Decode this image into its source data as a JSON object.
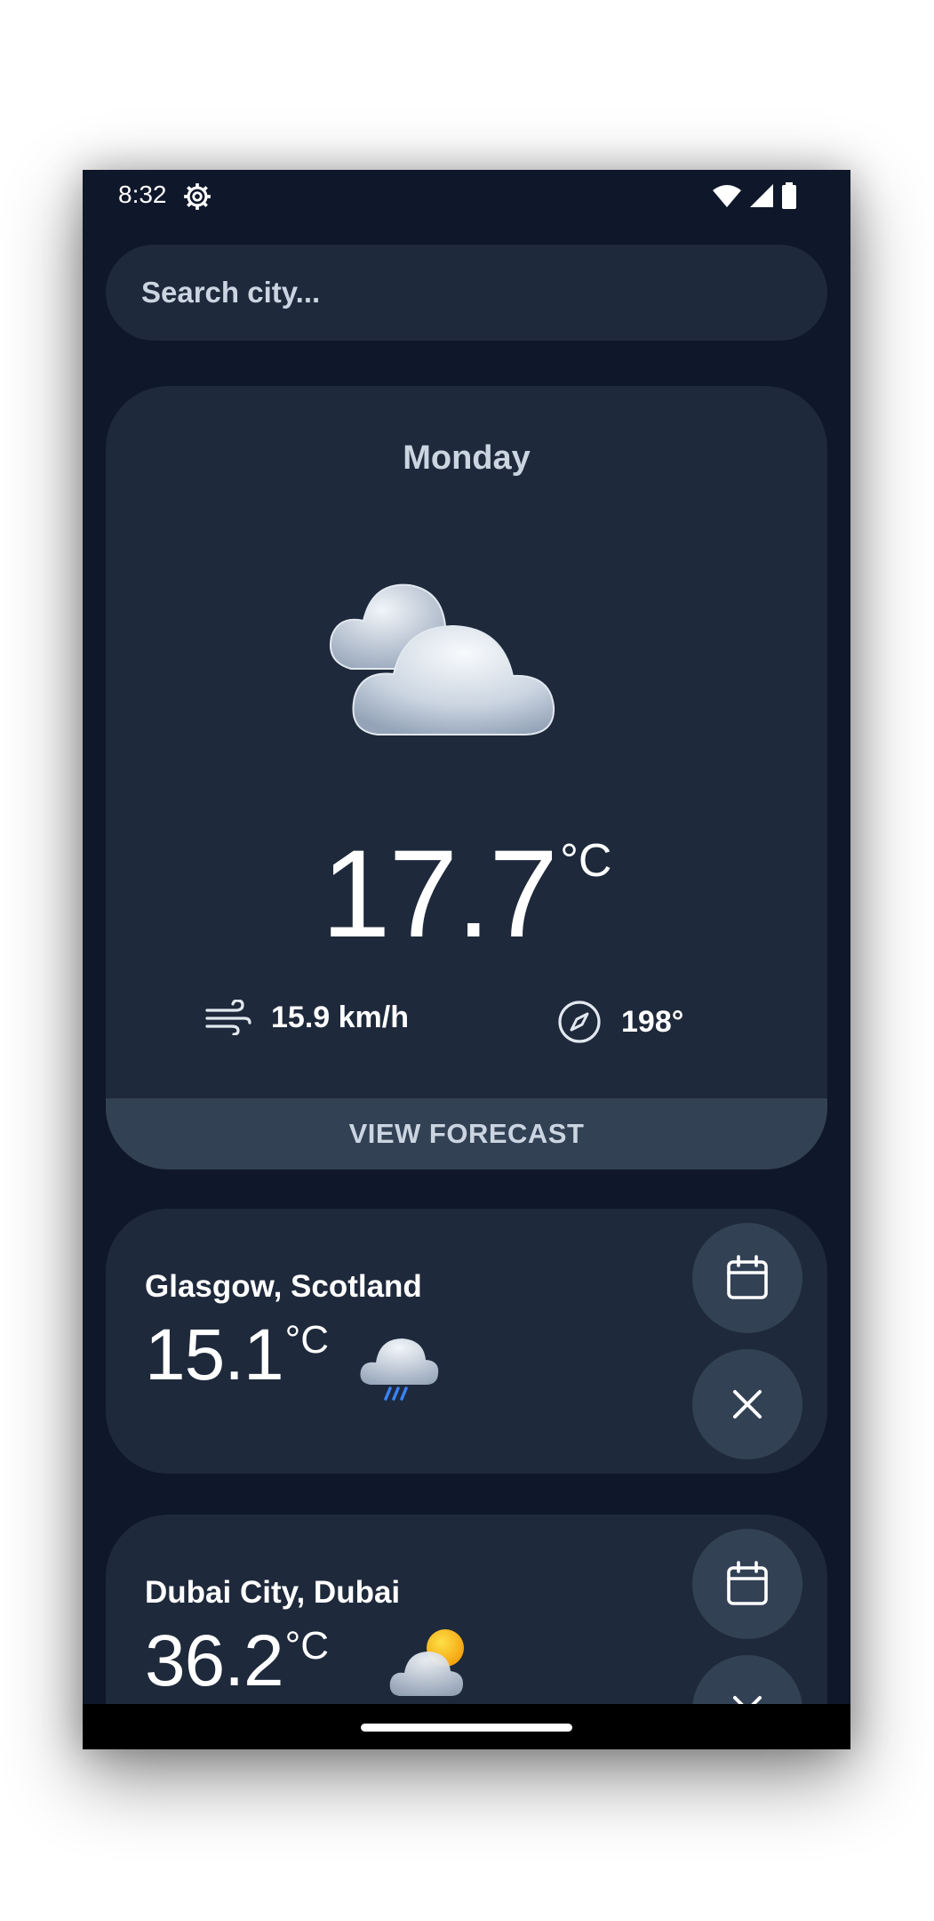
{
  "status_bar": {
    "time": "8:32"
  },
  "search": {
    "placeholder": "Search city..."
  },
  "current": {
    "day": "Monday",
    "temperature": "17.7",
    "unit": "°C",
    "wind_speed": "15.9 km/h",
    "wind_direction": "198°",
    "forecast_button": "VIEW FORECAST",
    "icon": "cloudy-icon"
  },
  "cities": [
    {
      "name": "Glasgow, Scotland",
      "temperature": "15.1",
      "unit": "°C",
      "icon": "rain-cloud-icon"
    },
    {
      "name": "Dubai City, Dubai",
      "temperature": "36.2",
      "unit": "°C",
      "icon": "partly-sunny-icon"
    }
  ],
  "colors": {
    "background": "#0f172a",
    "card": "#1e293b",
    "button": "#334155",
    "text_muted": "#cbd5e1",
    "sun": "#f59e0b",
    "rain": "#3b82f6"
  }
}
